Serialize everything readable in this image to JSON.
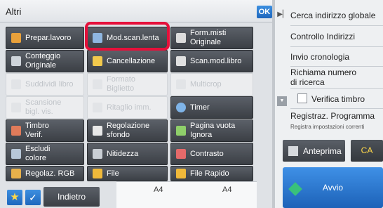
{
  "header": {
    "title": "Altri",
    "ok_label": "OK"
  },
  "functions": [
    {
      "label": "Prepar.lavoro",
      "enabled": true,
      "icon": "clipboard-icon"
    },
    {
      "label": "Mod.scan.lenta",
      "enabled": true,
      "icon": "slow-scan-icon",
      "highlighted": true
    },
    {
      "label": "Form.misti\nOriginale",
      "enabled": true,
      "icon": "mixed-size-icon"
    },
    {
      "label": "Conteggio\nOriginale",
      "enabled": true,
      "icon": "counter-icon"
    },
    {
      "label": "Cancellazione",
      "enabled": true,
      "icon": "eraser-icon"
    },
    {
      "label": "Scan.mod.libro",
      "enabled": true,
      "icon": "book-icon"
    },
    {
      "label": "Suddividi libro",
      "enabled": false,
      "icon": "split-book-icon"
    },
    {
      "label": "Formato\nBiglietto",
      "enabled": false,
      "icon": "card-icon"
    },
    {
      "label": "Multicrop",
      "enabled": false,
      "icon": "multicrop-icon"
    },
    {
      "label": "Scansione\nbigl. vis.",
      "enabled": false,
      "icon": "business-card-icon"
    },
    {
      "label": "Ritaglio imm.",
      "enabled": false,
      "icon": "crop-icon"
    },
    {
      "label": "Timer",
      "enabled": true,
      "icon": "clock-icon"
    },
    {
      "label": "Timbro\nVerif.",
      "enabled": true,
      "icon": "stamp-icon"
    },
    {
      "label": "Regolazione\nsfondo",
      "enabled": true,
      "icon": "background-icon"
    },
    {
      "label": "Pagina vuota\nIgnora",
      "enabled": true,
      "icon": "blank-page-icon"
    },
    {
      "label": "Escludi\ncolore",
      "enabled": true,
      "icon": "color-exclude-icon"
    },
    {
      "label": "Nitidezza",
      "enabled": true,
      "icon": "sharpness-icon"
    },
    {
      "label": "Contrasto",
      "enabled": true,
      "icon": "contrast-icon"
    },
    {
      "label": "Regolaz. RGB",
      "enabled": true,
      "icon": "rgb-icon"
    },
    {
      "label": "File",
      "enabled": true,
      "icon": "folder-icon"
    },
    {
      "label": "File Rapido",
      "enabled": true,
      "icon": "quick-file-icon"
    }
  ],
  "bottom": {
    "back_label": "Indietro",
    "paper_left": "A4",
    "paper_right": "A4"
  },
  "side_menu": {
    "items": [
      "Cerca indirizzo globale",
      "Controllo Indirizzi",
      "Invio cronologia",
      "Richiama numero\ndi ricerca",
      "Verifica timbro",
      "Registraz. Programma"
    ],
    "register_sub": "Registra impostazioni correnti"
  },
  "actions": {
    "preview_label": "Anteprima",
    "ca_label": "CA",
    "start_label": "Avvio"
  },
  "colors": {
    "accent": "#1e67bd",
    "highlight": "#e5103a",
    "start_icon": "#39c17b"
  }
}
